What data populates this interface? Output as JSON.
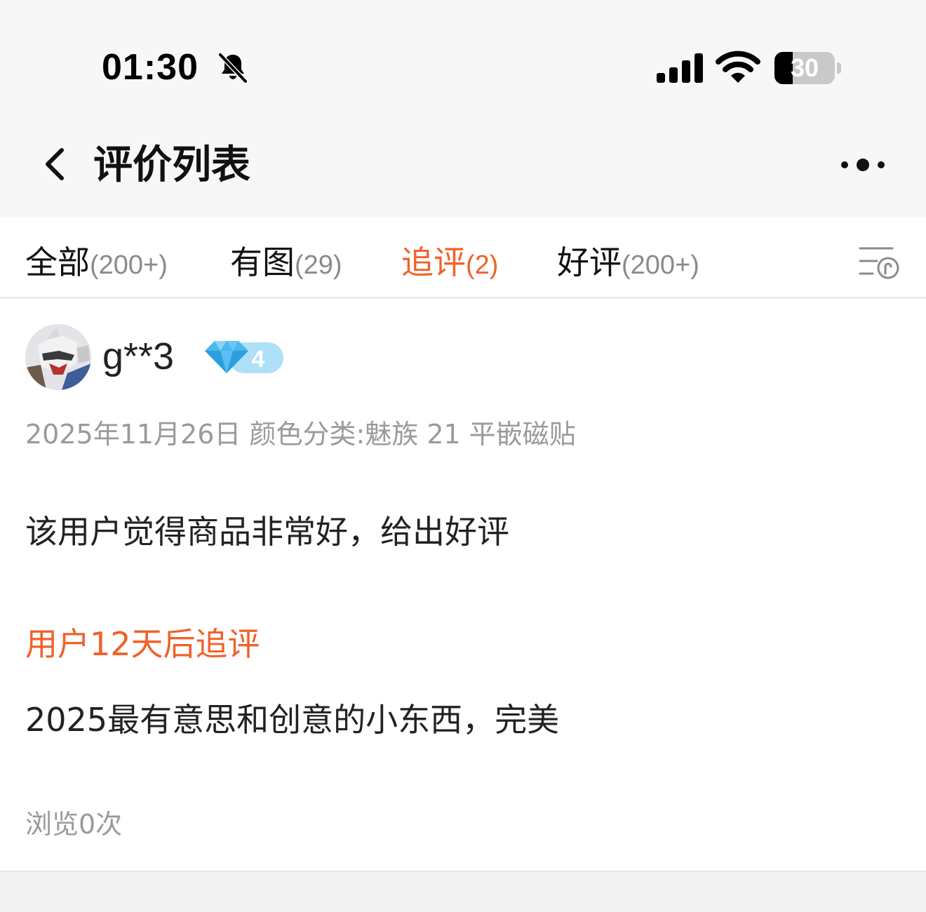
{
  "status_bar": {
    "time": "01:30",
    "battery_level": "30",
    "battery_percent": 30
  },
  "nav": {
    "title": "评价列表"
  },
  "tabs": [
    {
      "label": "全部",
      "count": "(200+)",
      "active": false
    },
    {
      "label": "有图",
      "count": "(29)",
      "active": false
    },
    {
      "label": "追评",
      "count": "(2)",
      "active": true
    },
    {
      "label": "好评",
      "count": "(200+)",
      "active": false
    }
  ],
  "review": {
    "username": "g**3",
    "level": "4",
    "meta": "2025年11月26日 颜色分类:魅族 21 平嵌磁贴",
    "text": "该用户觉得商品非常好，给出好评",
    "followup_label": "用户12天后追评",
    "followup_text": "2025最有意思和创意的小东西，完美",
    "views": "浏览0次"
  },
  "colors": {
    "accent": "#f0622a",
    "muted": "#9a9a9a",
    "badge_blue": "#5cc3f0"
  }
}
